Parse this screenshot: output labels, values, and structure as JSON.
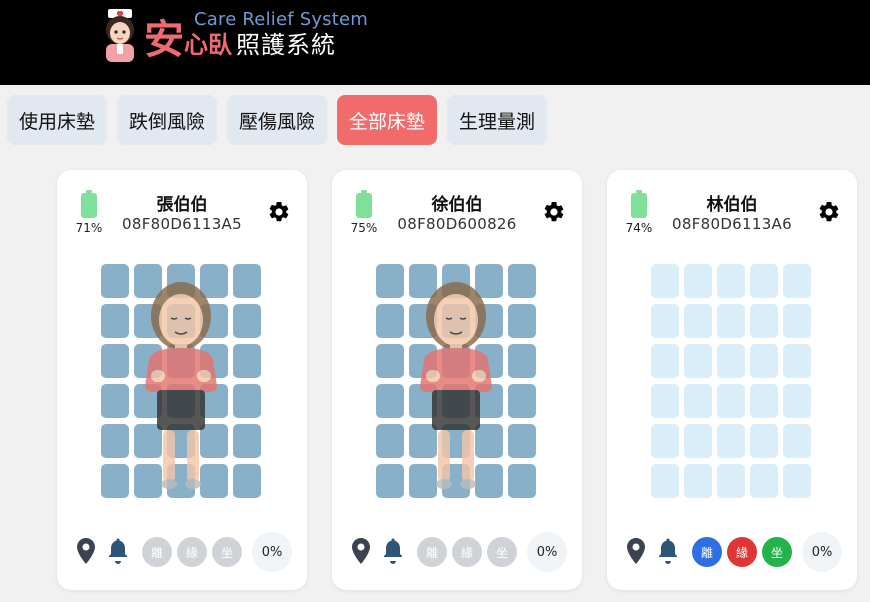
{
  "header": {
    "logo_en": "Care Relief System",
    "logo_cn_big": "安",
    "logo_cn_mid": "心臥",
    "logo_cn_rest": "照護系統"
  },
  "tabs": [
    {
      "label": "使用床墊",
      "active": false
    },
    {
      "label": "跌倒風險",
      "active": false
    },
    {
      "label": "壓傷風險",
      "active": false
    },
    {
      "label": "全部床墊",
      "active": true
    },
    {
      "label": "生理量測",
      "active": false
    }
  ],
  "cards": [
    {
      "name": "張伯伯",
      "device_id": "08F80D6113A5",
      "battery": "71%",
      "occupied": true,
      "badges": [
        {
          "label": "離",
          "color": "gray"
        },
        {
          "label": "緣",
          "color": "gray"
        },
        {
          "label": "坐",
          "color": "gray"
        }
      ],
      "percent": "0%"
    },
    {
      "name": "徐伯伯",
      "device_id": "08F80D600826",
      "battery": "75%",
      "occupied": true,
      "badges": [
        {
          "label": "離",
          "color": "gray"
        },
        {
          "label": "緣",
          "color": "gray"
        },
        {
          "label": "坐",
          "color": "gray"
        }
      ],
      "percent": "0%"
    },
    {
      "name": "林伯伯",
      "device_id": "08F80D6113A6",
      "battery": "74%",
      "occupied": false,
      "badges": [
        {
          "label": "離",
          "color": "blue"
        },
        {
          "label": "緣",
          "color": "red"
        },
        {
          "label": "坐",
          "color": "green"
        }
      ],
      "percent": "0%"
    }
  ],
  "colors": {
    "accent_active_tab": "#f26b6b",
    "sensor_active": "#89b0c9",
    "sensor_idle": "#d9eef8",
    "battery": "#7fe09a"
  },
  "icons": [
    "nurse-logo-icon",
    "battery-icon",
    "gear-icon",
    "location-pin-icon",
    "bell-icon"
  ]
}
